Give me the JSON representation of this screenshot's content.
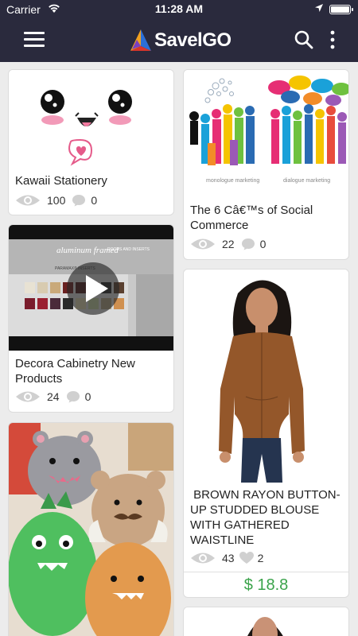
{
  "status_bar": {
    "carrier": "Carrier",
    "time": "11:28 AM"
  },
  "header": {
    "brand": "SavelGO",
    "menu_icon": "hamburger-icon",
    "search_icon": "search-icon",
    "more_icon": "more-vertical-icon"
  },
  "colors": {
    "header_bg": "#2a2a3d",
    "price_green": "#3aa34a",
    "background": "#ececec"
  },
  "cards": {
    "kawaii": {
      "title": "Kawaii Stationery",
      "views": "100",
      "comments": "0"
    },
    "social": {
      "title": "The 6 Câ€™s of Social Commerce",
      "views": "22",
      "comments": "0",
      "image_caption_left": "monologue marketing",
      "image_caption_right": "dialogue marketing"
    },
    "decora": {
      "title": "Decora Cabinetry New Products",
      "views": "24",
      "comments": "0",
      "image_text_top": "aluminum framed",
      "image_text_sub": "DOORS AND INSERTS",
      "image_text_brand": "PARAMAX® INSERTS"
    },
    "blouse": {
      "title": " BROWN RAYON BUTTON-UP STUDDED BLOUSE WITH GATHERED WAISTLINE",
      "views": "43",
      "likes": "2",
      "price": "$ 18.8"
    }
  }
}
